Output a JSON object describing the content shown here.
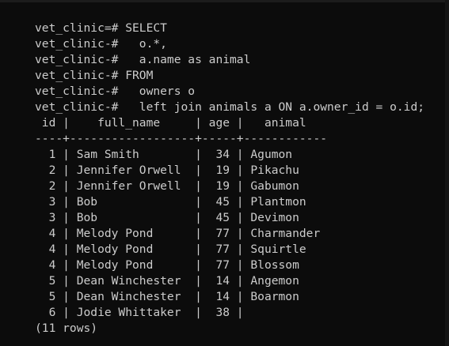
{
  "window": {
    "lines": [
      "vet_clinic=# SELECT",
      "vet_clinic-#   o.*,",
      "vet_clinic-#   a.name as animal",
      "vet_clinic-# FROM",
      "vet_clinic-#   owners o",
      "vet_clinic-#   left join animals a ON a.owner_id = o.id;",
      " id |    full_name     | age |   animal",
      "----+------------------+-----+------------",
      "  1 | Sam Smith        |  34 | Agumon",
      "  2 | Jennifer Orwell  |  19 | Pikachu",
      "  2 | Jennifer Orwell  |  19 | Gabumon",
      "  3 | Bob              |  45 | Plantmon",
      "  3 | Bob              |  45 | Devimon",
      "  4 | Melody Pond      |  77 | Charmander",
      "  4 | Melody Pond      |  77 | Squirtle",
      "  4 | Melody Pond      |  77 | Blossom",
      "  5 | Dean Winchester  |  14 | Angemon",
      "  5 | Dean Winchester  |  14 | Boarmon",
      "  6 | Jodie Whittaker  |  38 |",
      "(11 rows)"
    ]
  },
  "colors": {
    "background": "#0c0c0c",
    "text": "#cccccc"
  }
}
